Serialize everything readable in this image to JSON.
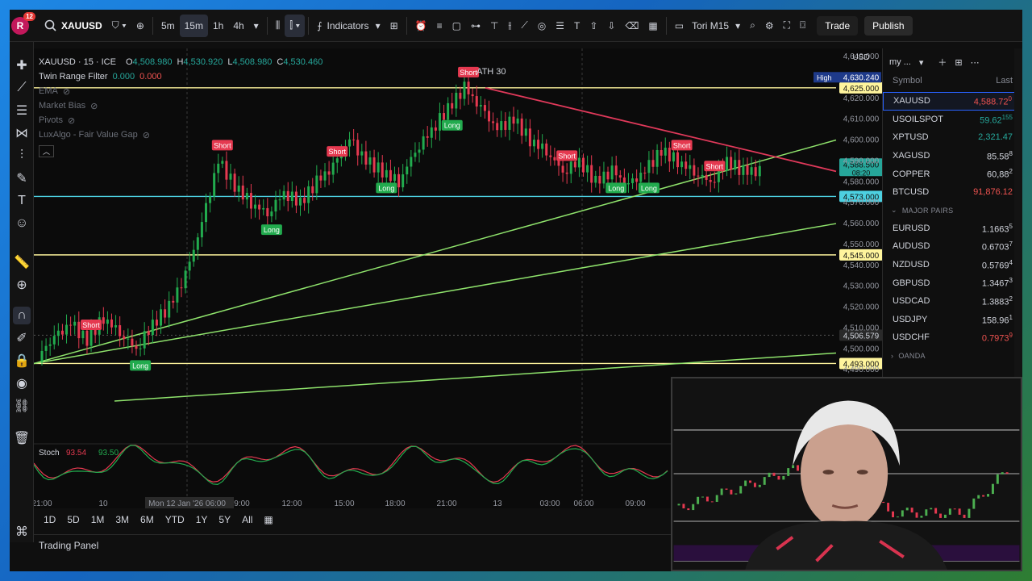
{
  "app": {
    "name": "TradingView",
    "avatar_letter": "R",
    "notification_count": "12"
  },
  "topbar": {
    "symbol": "XAUUSD",
    "intervals": [
      {
        "label": "5m",
        "active": false
      },
      {
        "label": "15m",
        "active": true
      },
      {
        "label": "1h",
        "active": false
      },
      {
        "label": "4h",
        "active": false
      }
    ],
    "indicators_label": "Indicators",
    "layout_name": "Tori M15",
    "trade_label": "Trade",
    "publish_label": "Publish"
  },
  "legend": {
    "title": "XAUUSD · 15 · ICE",
    "ohlc": [
      {
        "k": "O",
        "v": "4,508.980"
      },
      {
        "k": "H",
        "v": "4,530.920"
      },
      {
        "k": "L",
        "v": "4,508.980"
      },
      {
        "k": "C",
        "v": "4,530.460"
      }
    ],
    "indicators": [
      {
        "name": "Twin Range Filter",
        "values": [
          "0.000",
          "0.000"
        ],
        "dim": false
      },
      {
        "name": "EMA",
        "values": [],
        "dim": true
      },
      {
        "name": "Market Bias",
        "values": [],
        "dim": true
      },
      {
        "name": "Pivots",
        "values": [],
        "dim": true
      },
      {
        "name": "LuxAlgo - Fair Value Gap",
        "values": [],
        "dim": true
      }
    ]
  },
  "price_scale": {
    "currency": "USD",
    "ticks": [
      "4,640.000",
      "4,620.000",
      "4,610.000",
      "4,600.000",
      "4,590.000",
      "4,580.000",
      "4,570.000",
      "4,560.000",
      "4,550.000",
      "4,540.000",
      "4,530.000",
      "4,520.000",
      "4,510.000",
      "4,500.000",
      "4,490.000",
      "4,480.000"
    ],
    "high_label": "High",
    "high_value": "4,630.240",
    "levels": [
      {
        "value": "4,625.000",
        "style": "yellow"
      },
      {
        "value": "4,588.500",
        "style": "green",
        "sub": "08:20"
      },
      {
        "value": "4,573.000",
        "style": "cyan"
      },
      {
        "value": "4,545.000",
        "style": "yellow"
      },
      {
        "value": "4,506.579",
        "style": "grey"
      },
      {
        "value": "4,493.000",
        "style": "yellow"
      }
    ]
  },
  "chart_data": {
    "type": "candlestick",
    "symbol": "XAUUSD",
    "timeframe": "15",
    "y_unit": "USD",
    "ylim": [
      4470,
      4640
    ],
    "time_labels": [
      "21:00",
      "10",
      "Mon 12 Jan '26  06:00",
      "9:00",
      "12:00",
      "15:00",
      "18:00",
      "21:00",
      "13",
      "03:00",
      "06:00",
      "09:00"
    ],
    "close_path": [
      4497,
      4505,
      4512,
      4504,
      4515,
      4508,
      4500,
      4512,
      4520,
      4535,
      4560,
      4590,
      4578,
      4570,
      4565,
      4575,
      4570,
      4580,
      4587,
      4600,
      4590,
      4585,
      4580,
      4595,
      4605,
      4615,
      4625,
      4615,
      4605,
      4610,
      4600,
      4595,
      4585,
      4590,
      4580,
      4585,
      4578,
      4585,
      4595,
      4590,
      4585,
      4580,
      4590,
      4585
    ],
    "signals": [
      {
        "label": "Short",
        "kind": "short"
      },
      {
        "label": "Long",
        "kind": "long"
      },
      {
        "label": "Short",
        "kind": "short"
      },
      {
        "label": "Long",
        "kind": "long"
      },
      {
        "label": "Short",
        "kind": "short"
      },
      {
        "label": "Long",
        "kind": "long"
      },
      {
        "label": "Long",
        "kind": "long"
      },
      {
        "label": "Short",
        "kind": "short"
      },
      {
        "label": "Short",
        "kind": "short"
      },
      {
        "label": "Long",
        "kind": "long"
      },
      {
        "label": "Long",
        "kind": "long"
      },
      {
        "label": "Short",
        "kind": "short"
      },
      {
        "label": "Short",
        "kind": "short"
      }
    ],
    "ath_label": "ATH 30",
    "stoch_label": "Stoch",
    "stoch_values": [
      "93.54",
      "93.50"
    ]
  },
  "ranges": [
    "1D",
    "5D",
    "1M",
    "3M",
    "6M",
    "YTD",
    "1Y",
    "5Y",
    "All"
  ],
  "trading_panel_label": "Trading Panel",
  "watchlist": {
    "title": "my ...",
    "col_symbol": "Symbol",
    "col_last": "Last",
    "items": [
      {
        "sym": "XAUUSD",
        "last": "4,588.72",
        "sup": "0",
        "dir": "dn",
        "selected": true
      },
      {
        "sym": "USOILSPOT",
        "last": "59.62",
        "sup": "155",
        "dir": "up",
        "selected": false
      },
      {
        "sym": "XPTUSD",
        "last": "2,321.47",
        "sup": "",
        "dir": "up",
        "selected": false
      },
      {
        "sym": "XAGUSD",
        "last": "85.58",
        "sup": "8",
        "dir": "none",
        "selected": false
      },
      {
        "sym": "COPPER",
        "last": "60,88",
        "sup": "2",
        "dir": "none",
        "selected": false
      },
      {
        "sym": "BTCUSD",
        "last": "91,876.12",
        "sup": "",
        "dir": "dn",
        "selected": false
      }
    ],
    "section": "MAJOR PAIRS",
    "pairs": [
      {
        "sym": "EURUSD",
        "last": "1.1663",
        "sup": "5",
        "dir": "none"
      },
      {
        "sym": "AUDUSD",
        "last": "0.6703",
        "sup": "7",
        "dir": "none"
      },
      {
        "sym": "NZDUSD",
        "last": "0.5769",
        "sup": "4",
        "dir": "none"
      },
      {
        "sym": "GBPUSD",
        "last": "1.3467",
        "sup": "3",
        "dir": "none"
      },
      {
        "sym": "USDCAD",
        "last": "1.3883",
        "sup": "2",
        "dir": "none"
      },
      {
        "sym": "USDJPY",
        "last": "158.96",
        "sup": "1",
        "dir": "none"
      },
      {
        "sym": "USDCHF",
        "last": "0.7973",
        "sup": "9",
        "dir": "dn"
      }
    ],
    "section2": "OANDA"
  },
  "colors": {
    "up": "#26a69a",
    "down": "#ef5350",
    "long": "#22ab4e",
    "short": "#e53950",
    "level_yellow": "#fff59d",
    "level_cyan": "#4dd0e1",
    "trend": "#8fe36c",
    "resistance": "#e0395a"
  }
}
